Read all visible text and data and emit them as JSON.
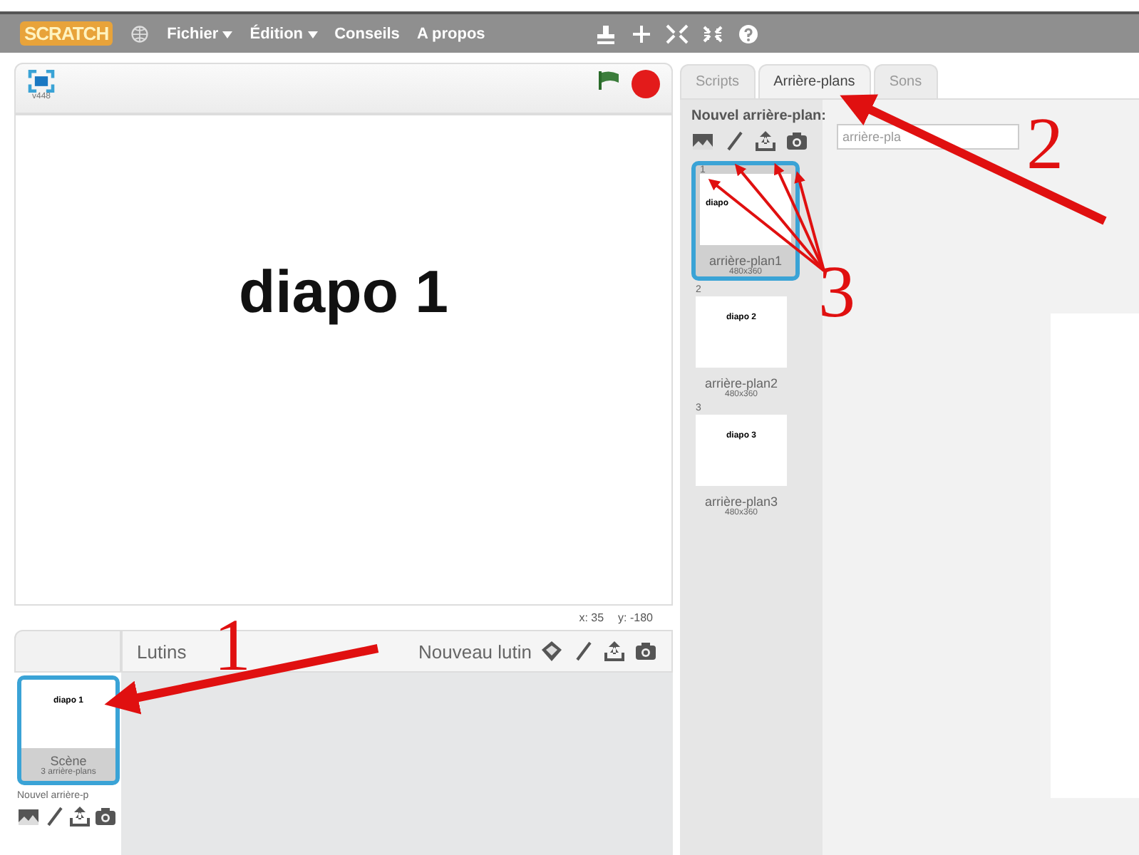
{
  "menu_bar": {
    "logo": "SCRATCH",
    "items": [
      {
        "label": "Fichier",
        "dropdown": true
      },
      {
        "label": "Édition",
        "dropdown": true
      },
      {
        "label": "Conseils",
        "dropdown": false
      },
      {
        "label": "A propos",
        "dropdown": false
      }
    ]
  },
  "stage": {
    "version": "v448",
    "slide_text": "diapo 1",
    "mouse_x": "x: 35",
    "mouse_y": "y: -180"
  },
  "sprites_pane": {
    "title": "Lutins",
    "new_sprite": "Nouveau lutin",
    "scene": {
      "thumb_text": "diapo 1",
      "name": "Scène",
      "info": "3 arrière-plans",
      "selected": true
    },
    "new_backdrop": "Nouvel arrière-p"
  },
  "tabs": [
    {
      "label": "Scripts",
      "selected": false
    },
    {
      "label": "Arrière-plans",
      "selected": true
    },
    {
      "label": "Sons",
      "selected": false
    }
  ],
  "backdrops": {
    "new_label": "Nouvel arrière-plan:",
    "name_value": "arrière-pla",
    "items": [
      {
        "number": "1",
        "thumb_text": "diapo",
        "name": "arrière-plan1",
        "size": "480x360",
        "selected": true
      },
      {
        "number": "2",
        "thumb_text": "diapo 2",
        "name": "arrière-plan2",
        "size": "480x360",
        "selected": false
      },
      {
        "number": "3",
        "thumb_text": "diapo 3",
        "name": "arrière-plan3",
        "size": "480x360",
        "selected": false
      }
    ]
  },
  "annotations": [
    {
      "label": "1"
    },
    {
      "label": "2"
    },
    {
      "label": "3"
    }
  ]
}
